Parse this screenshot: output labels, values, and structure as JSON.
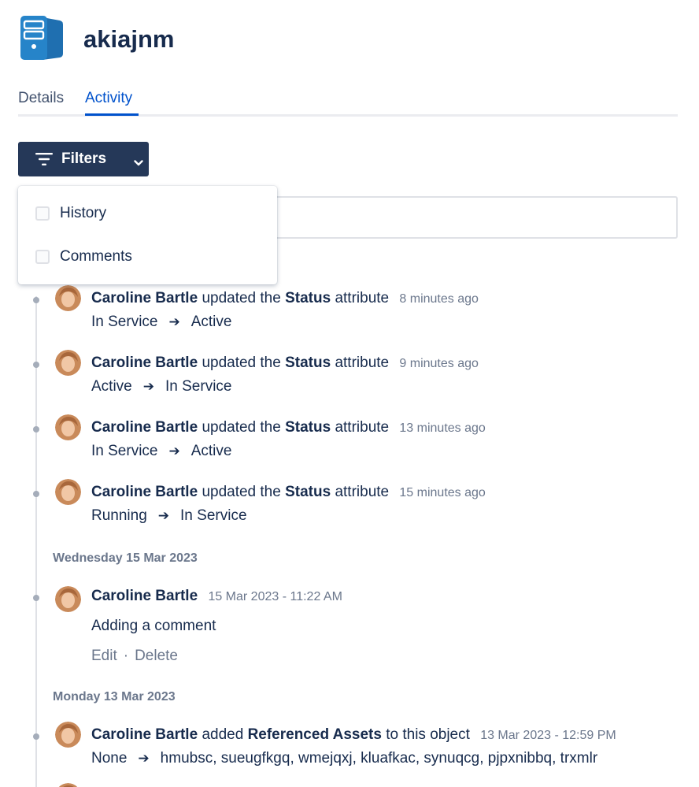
{
  "object": {
    "title": "akiajnm",
    "icon": "server-icon",
    "icon_color": "#2684c9"
  },
  "tabs": [
    {
      "label": "Details",
      "active": false
    },
    {
      "label": "Activity",
      "active": true
    }
  ],
  "filters": {
    "button_label": "Filters",
    "options": [
      {
        "label": "History",
        "checked": false
      },
      {
        "label": "Comments",
        "checked": false
      }
    ]
  },
  "activity": {
    "entries": [
      {
        "user": "Caroline Bartle",
        "verb": "updated the",
        "attribute": "Status",
        "suffix": "attribute",
        "time": "8 minutes ago",
        "from": "In Service",
        "to": "Active"
      },
      {
        "user": "Caroline Bartle",
        "verb": "updated the",
        "attribute": "Status",
        "suffix": "attribute",
        "time": "9 minutes ago",
        "from": "Active",
        "to": "In Service"
      },
      {
        "user": "Caroline Bartle",
        "verb": "updated the",
        "attribute": "Status",
        "suffix": "attribute",
        "time": "13 minutes ago",
        "from": "In Service",
        "to": "Active"
      },
      {
        "user": "Caroline Bartle",
        "verb": "updated the",
        "attribute": "Status",
        "suffix": "attribute",
        "time": "15 minutes ago",
        "from": "Running",
        "to": "In Service"
      }
    ],
    "date_groups": [
      {
        "label": "Wednesday 15 Mar 2023"
      },
      {
        "label": "Monday 13 Mar 2023"
      }
    ],
    "comment": {
      "user": "Caroline Bartle",
      "time": "15 Mar 2023 - 11:22 AM",
      "text": "Adding a comment",
      "edit_label": "Edit",
      "separator": "·",
      "delete_label": "Delete"
    },
    "reference_entry": {
      "user": "Caroline Bartle",
      "verb": "added",
      "attribute": "Referenced Assets",
      "suffix": "to this object",
      "time": "13 Mar 2023 - 12:59 PM",
      "from": "None",
      "to": "hmubsc, sueugfkgq, wmejqxj, kluafkac, synuqcg, pjpxnibbq, trxmlr"
    }
  }
}
